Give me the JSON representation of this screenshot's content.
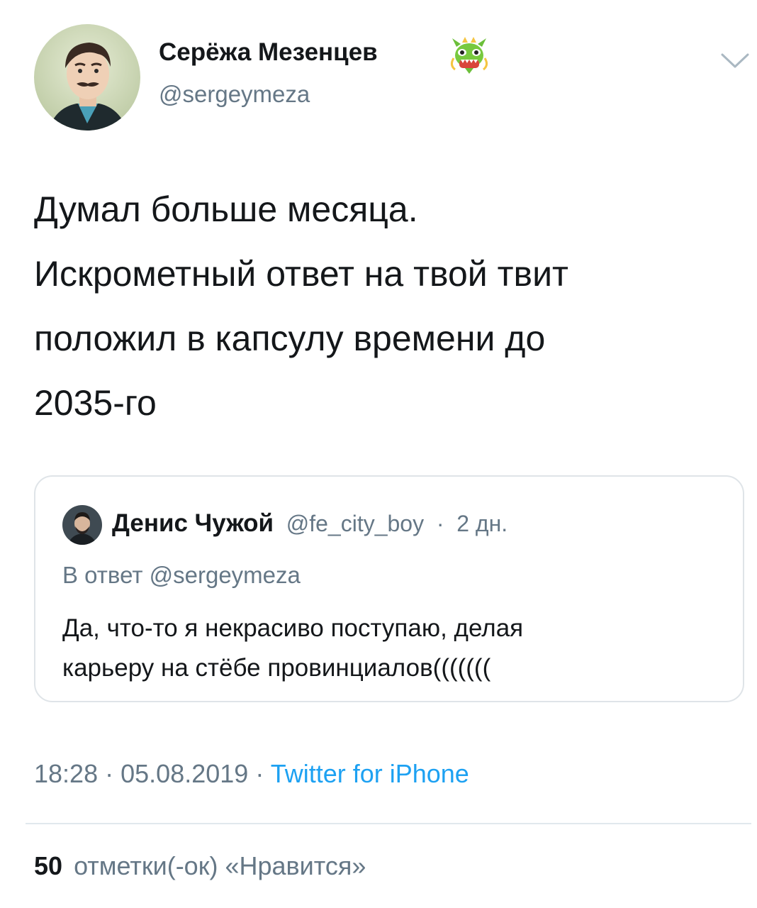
{
  "tweet": {
    "author_name": "Серёжа Мезенцев",
    "author_emoji_icon": "dragon-face-icon",
    "author_handle": "@sergeymeza",
    "text_lines": [
      "Думал больше месяца.",
      "Искрометный ответ на твой твит",
      "положил в капсулу времени до",
      "2035-го"
    ]
  },
  "quote": {
    "author_name": "Денис Чужой",
    "author_handle": "@fe_city_boy",
    "separator": "·",
    "age": "2 дн.",
    "reply_to": "В ответ @sergeymeza",
    "text_lines": [
      "Да, что-то я некрасиво поступаю, делая",
      "карьеру на стёбе провинциалов((((((("
    ]
  },
  "meta": {
    "time": "18:28",
    "separator": "·",
    "date": "05.08.2019",
    "source": "Twitter for iPhone"
  },
  "likes": {
    "count": "50",
    "label": "отметки(-ок) «Нравится»"
  },
  "colors": {
    "text": "#14171a",
    "secondary": "#657786",
    "link": "#1da1f2",
    "border": "#dfe4e8"
  }
}
